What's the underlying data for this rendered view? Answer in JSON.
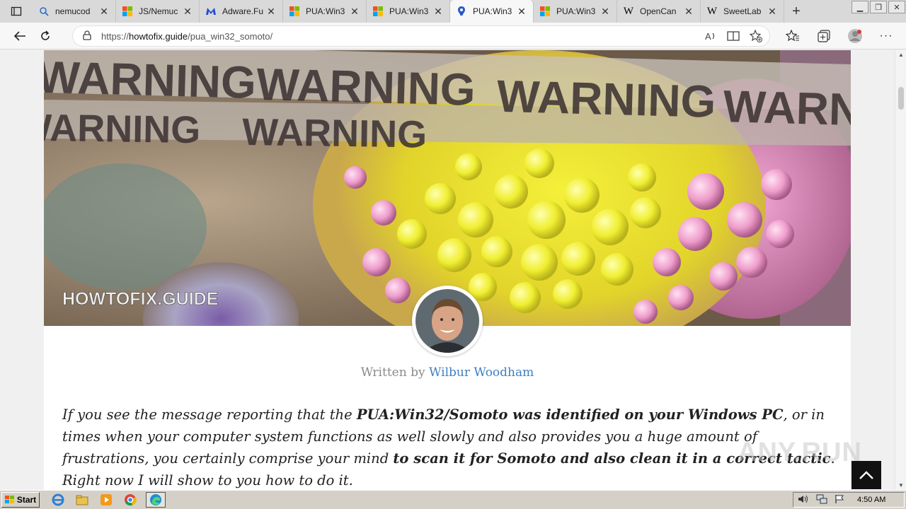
{
  "browser": {
    "tabs": [
      {
        "label": "nemucod",
        "icon": "search-icon",
        "active": false
      },
      {
        "label": "JS/Nemuc",
        "icon": "microsoft-logo-icon",
        "active": false
      },
      {
        "label": "Adware.Fu",
        "icon": "malwarebytes-icon",
        "active": false
      },
      {
        "label": "PUA:Win3",
        "icon": "microsoft-logo-icon",
        "active": false
      },
      {
        "label": "PUA:Win3",
        "icon": "microsoft-logo-icon",
        "active": false
      },
      {
        "label": "PUA:Win3",
        "icon": "howtofix-pin-icon",
        "active": true
      },
      {
        "label": "PUA:Win3",
        "icon": "microsoft-logo-icon",
        "active": false
      },
      {
        "label": "OpenCan",
        "icon": "wikipedia-icon",
        "active": false
      },
      {
        "label": "SweetLab",
        "icon": "wikipedia-icon",
        "active": false
      }
    ],
    "url_prefix": "https://",
    "url_host": "howtofix.guide",
    "url_path": "/pua_win32_somoto/"
  },
  "page": {
    "hero_watermark": "HOWTOFIX.GUIDE",
    "hero_banner_word": "WARNING",
    "byline_prefix": "Written by",
    "author": "Wilbur Woodham",
    "intro": {
      "p1": "If you see the message reporting that the ",
      "b1": "PUA:Win32/Somoto was identified on your Windows PC",
      "p2": ", or in times when your computer system functions as well slowly and also provides you a huge amount of frustrations, you certainly comprise your mind ",
      "b2": "to scan it for Somoto and also clean it in a correct tactic",
      "p3": ". Right now I will show to you how to do it."
    }
  },
  "overlay": {
    "watermark": "ANY.RUN"
  },
  "taskbar": {
    "start_label": "Start",
    "clock": "4:50 AM"
  },
  "colors": {
    "link": "#3f7fbf",
    "tabbar": "#d9d9d9",
    "taskbar": "#d4d0c8"
  }
}
